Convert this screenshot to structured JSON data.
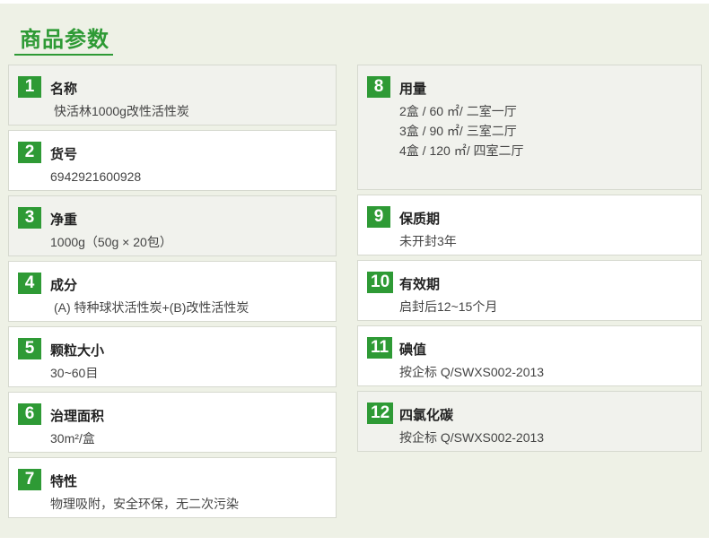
{
  "title": "商品参数",
  "items": [
    {
      "num": "1",
      "label": "名称",
      "lines": [
        "快活林1000g改性活性炭"
      ]
    },
    {
      "num": "2",
      "label": "货号",
      "lines": [
        "6942921600928"
      ]
    },
    {
      "num": "3",
      "label": "净重",
      "lines": [
        "1000g（50g × 20包）"
      ]
    },
    {
      "num": "4",
      "label": "成分",
      "lines": [
        "(A) 特种球状活性炭+(B)改性活性炭"
      ]
    },
    {
      "num": "5",
      "label": "颗粒大小",
      "lines": [
        "30~60目"
      ]
    },
    {
      "num": "6",
      "label": "治理面积",
      "lines": [
        "30m²/盒"
      ]
    },
    {
      "num": "7",
      "label": "特性",
      "lines": [
        "物理吸附，安全环保，无二次污染"
      ]
    },
    {
      "num": "8",
      "label": "用量",
      "lines": [
        "2盒 / 60 ㎡/ 二室一厅",
        "3盒 / 90 ㎡/ 三室二厅",
        "4盒 / 120 ㎡/ 四室二厅"
      ]
    },
    {
      "num": "9",
      "label": "保质期",
      "lines": [
        "未开封3年"
      ]
    },
    {
      "num": "10",
      "label": "有效期",
      "lines": [
        "启封后12~15个月"
      ]
    },
    {
      "num": "11",
      "label": "碘值",
      "lines": [
        "按企标 Q/SWXS002-2013"
      ]
    },
    {
      "num": "12",
      "label": "四氯化碳",
      "lines": [
        "按企标 Q/SWXS002-2013"
      ]
    }
  ]
}
